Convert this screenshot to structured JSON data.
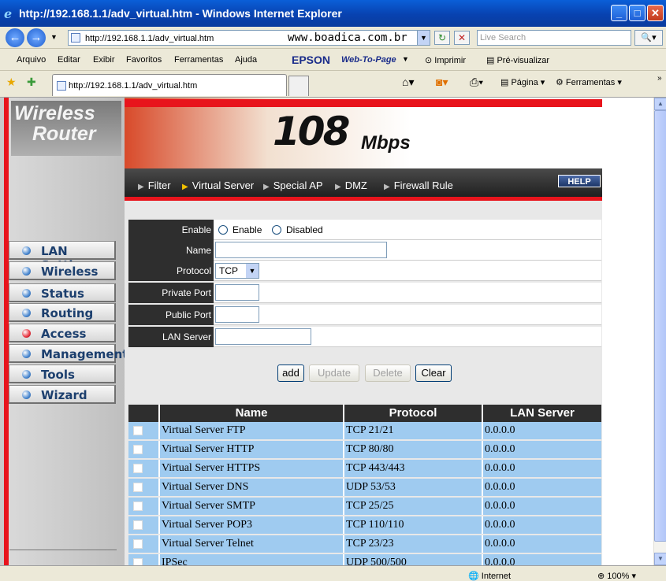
{
  "window": {
    "title": "http://192.168.1.1/adv_virtual.htm - Windows Internet Explorer"
  },
  "address_bar": {
    "url": "http://192.168.1.1/adv_virtual.htm",
    "watermark": "www.boadica.com.br",
    "search_placeholder": "Live Search"
  },
  "menu": {
    "items": [
      "Arquivo",
      "Editar",
      "Exibir",
      "Favoritos",
      "Ferramentas",
      "Ajuda"
    ],
    "epson": "EPSON",
    "web_to_page": "Web-To-Page",
    "print": "Imprimir",
    "preview": "Pré-visualizar"
  },
  "tabs": {
    "active_tab": "http://192.168.1.1/adv_virtual.htm"
  },
  "toolbar": {
    "page": "Página",
    "tools": "Ferramentas"
  },
  "router": {
    "logo_line1": "Wireless",
    "logo_line2": "Router",
    "banner_speed": "108",
    "banner_unit": "Mbps",
    "sidebar": [
      {
        "label": "LAN Setting",
        "active": false
      },
      {
        "label": "Wireless",
        "active": false
      },
      {
        "label": "Status",
        "active": false
      },
      {
        "label": "Routing",
        "active": false
      },
      {
        "label": "Access",
        "active": true
      },
      {
        "label": "Management",
        "active": false
      },
      {
        "label": "Tools",
        "active": false
      },
      {
        "label": "Wizard",
        "active": false
      }
    ],
    "subnav": [
      {
        "label": "Filter",
        "active": false
      },
      {
        "label": "Virtual Server",
        "active": true
      },
      {
        "label": "Special AP",
        "active": false
      },
      {
        "label": "DMZ",
        "active": false
      },
      {
        "label": "Firewall Rule",
        "active": false
      }
    ],
    "help": "HELP"
  },
  "form": {
    "enable_label": "Enable",
    "enable_option": "Enable",
    "disabled_option": "Disabled",
    "name_label": "Name",
    "protocol_label": "Protocol",
    "protocol_value": "TCP",
    "private_port_label": "Private Port",
    "public_port_label": "Public Port",
    "lan_server_label": "LAN Server",
    "buttons": {
      "add": "add",
      "update": "Update",
      "delete": "Delete",
      "clear": "Clear"
    }
  },
  "table": {
    "headers": [
      "Name",
      "Protocol",
      "LAN Server"
    ],
    "rows": [
      {
        "name": "Virtual Server FTP",
        "protocol": "TCP 21/21",
        "server": "0.0.0.0"
      },
      {
        "name": "Virtual Server HTTP",
        "protocol": "TCP 80/80",
        "server": "0.0.0.0"
      },
      {
        "name": "Virtual Server HTTPS",
        "protocol": "TCP 443/443",
        "server": "0.0.0.0"
      },
      {
        "name": "Virtual Server DNS",
        "protocol": "UDP 53/53",
        "server": "0.0.0.0"
      },
      {
        "name": "Virtual Server SMTP",
        "protocol": "TCP 25/25",
        "server": "0.0.0.0"
      },
      {
        "name": "Virtual Server POP3",
        "protocol": "TCP 110/110",
        "server": "0.0.0.0"
      },
      {
        "name": "Virtual Server Telnet",
        "protocol": "TCP 23/23",
        "server": "0.0.0.0"
      },
      {
        "name": "IPSec",
        "protocol": "UDP 500/500",
        "server": "0.0.0.0"
      }
    ]
  },
  "status_bar": {
    "zone": "Internet",
    "zoom": "100%"
  }
}
